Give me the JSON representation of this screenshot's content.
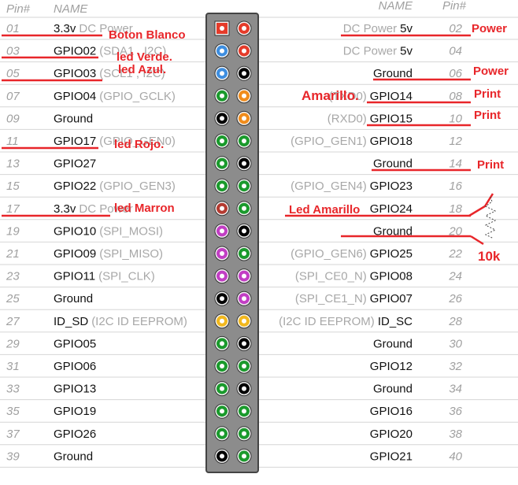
{
  "header": {
    "left_pin": "Pin#",
    "left_name": "NAME",
    "right_name": "NAME",
    "right_pin": "Pin#"
  },
  "pin_colors": {
    "red": "#e53b2a",
    "blue": "#3d8ee0",
    "black": "#000000",
    "green": "#1a9a2c",
    "orange": "#f08c1c",
    "brown": "#b43a30",
    "purple": "#c23ec4",
    "yellow": "#f2b81e"
  },
  "rows": [
    {
      "left": {
        "pin": "01",
        "name": "3.3v",
        "extra": "DC Power",
        "color": "red",
        "square": true
      },
      "right": {
        "pin": "02",
        "name": "5v",
        "extra": "DC Power",
        "color": "red"
      }
    },
    {
      "left": {
        "pin": "03",
        "name": "GPIO02",
        "extra": "(SDA1 , I2C)",
        "color": "blue"
      },
      "right": {
        "pin": "04",
        "name": "5v",
        "extra": "DC Power",
        "color": "red"
      }
    },
    {
      "left": {
        "pin": "05",
        "name": "GPIO03",
        "extra": "(SCL1 , I2C)",
        "color": "blue"
      },
      "right": {
        "pin": "06",
        "name": "Ground",
        "extra": "",
        "color": "black"
      }
    },
    {
      "left": {
        "pin": "07",
        "name": "GPIO04",
        "extra": "(GPIO_GCLK)",
        "color": "green"
      },
      "right": {
        "pin": "08",
        "name": "GPIO14",
        "extra": "(TXD0)",
        "color": "orange"
      }
    },
    {
      "left": {
        "pin": "09",
        "name": "Ground",
        "extra": "",
        "color": "black"
      },
      "right": {
        "pin": "10",
        "name": "GPIO15",
        "extra": "(RXD0)",
        "color": "orange"
      }
    },
    {
      "left": {
        "pin": "11",
        "name": "GPIO17",
        "extra": "(GPIO_GEN0)",
        "color": "green"
      },
      "right": {
        "pin": "12",
        "name": "GPIO18",
        "extra": "(GPIO_GEN1)",
        "color": "green"
      }
    },
    {
      "left": {
        "pin": "13",
        "name": "GPIO27",
        "extra": "",
        "color": "green"
      },
      "right": {
        "pin": "14",
        "name": "Ground",
        "extra": "",
        "color": "black"
      }
    },
    {
      "left": {
        "pin": "15",
        "name": "GPIO22",
        "extra": "(GPIO_GEN3)",
        "color": "green"
      },
      "right": {
        "pin": "16",
        "name": "GPIO23",
        "extra": "(GPIO_GEN4)",
        "color": "green"
      }
    },
    {
      "left": {
        "pin": "17",
        "name": "3.3v",
        "extra": "DC Power",
        "color": "brown"
      },
      "right": {
        "pin": "18",
        "name": "GPIO24",
        "extra": "",
        "color": "green"
      }
    },
    {
      "left": {
        "pin": "19",
        "name": "GPIO10",
        "extra": "(SPI_MOSI)",
        "color": "purple"
      },
      "right": {
        "pin": "20",
        "name": "Ground",
        "extra": "",
        "color": "black"
      }
    },
    {
      "left": {
        "pin": "21",
        "name": "GPIO09",
        "extra": "(SPI_MISO)",
        "color": "purple"
      },
      "right": {
        "pin": "22",
        "name": "GPIO25",
        "extra": "(GPIO_GEN6)",
        "color": "green"
      }
    },
    {
      "left": {
        "pin": "23",
        "name": "GPIO11",
        "extra": "(SPI_CLK)",
        "color": "purple"
      },
      "right": {
        "pin": "24",
        "name": "GPIO08",
        "extra": "(SPI_CE0_N)",
        "color": "purple"
      }
    },
    {
      "left": {
        "pin": "25",
        "name": "Ground",
        "extra": "",
        "color": "black"
      },
      "right": {
        "pin": "26",
        "name": "GPIO07",
        "extra": "(SPI_CE1_N)",
        "color": "purple"
      }
    },
    {
      "left": {
        "pin": "27",
        "name": "ID_SD",
        "extra": "(I2C ID EEPROM)",
        "color": "yellow"
      },
      "right": {
        "pin": "28",
        "name": "ID_SC",
        "extra": "(I2C ID EEPROM)",
        "color": "yellow"
      }
    },
    {
      "left": {
        "pin": "29",
        "name": "GPIO05",
        "extra": "",
        "color": "green"
      },
      "right": {
        "pin": "30",
        "name": "Ground",
        "extra": "",
        "color": "black"
      }
    },
    {
      "left": {
        "pin": "31",
        "name": "GPIO06",
        "extra": "",
        "color": "green"
      },
      "right": {
        "pin": "32",
        "name": "GPIO12",
        "extra": "",
        "color": "green"
      }
    },
    {
      "left": {
        "pin": "33",
        "name": "GPIO13",
        "extra": "",
        "color": "green"
      },
      "right": {
        "pin": "34",
        "name": "Ground",
        "extra": "",
        "color": "black"
      }
    },
    {
      "left": {
        "pin": "35",
        "name": "GPIO19",
        "extra": "",
        "color": "green"
      },
      "right": {
        "pin": "36",
        "name": "GPIO16",
        "extra": "",
        "color": "green"
      }
    },
    {
      "left": {
        "pin": "37",
        "name": "GPIO26",
        "extra": "",
        "color": "green"
      },
      "right": {
        "pin": "38",
        "name": "GPIO20",
        "extra": "",
        "color": "green"
      }
    },
    {
      "left": {
        "pin": "39",
        "name": "Ground",
        "extra": "",
        "color": "black"
      },
      "right": {
        "pin": "40",
        "name": "GPIO21",
        "extra": "",
        "color": "green"
      }
    }
  ],
  "annotations": {
    "boton_blanco": "Boton Blanco",
    "led_verde": "led Verde.",
    "led_azul": "led Azul.",
    "led_rojo": "led Rojo.",
    "led_marron": "led Marron",
    "power_1": "Power",
    "power_2": "Power",
    "amarillo": "Amarillo.",
    "print_1": "Print",
    "print_2": "Print",
    "print_3": "Print",
    "led_amarillo": "Led Amarillo",
    "resistor": "10k",
    "accent_color": "#e8262a"
  }
}
